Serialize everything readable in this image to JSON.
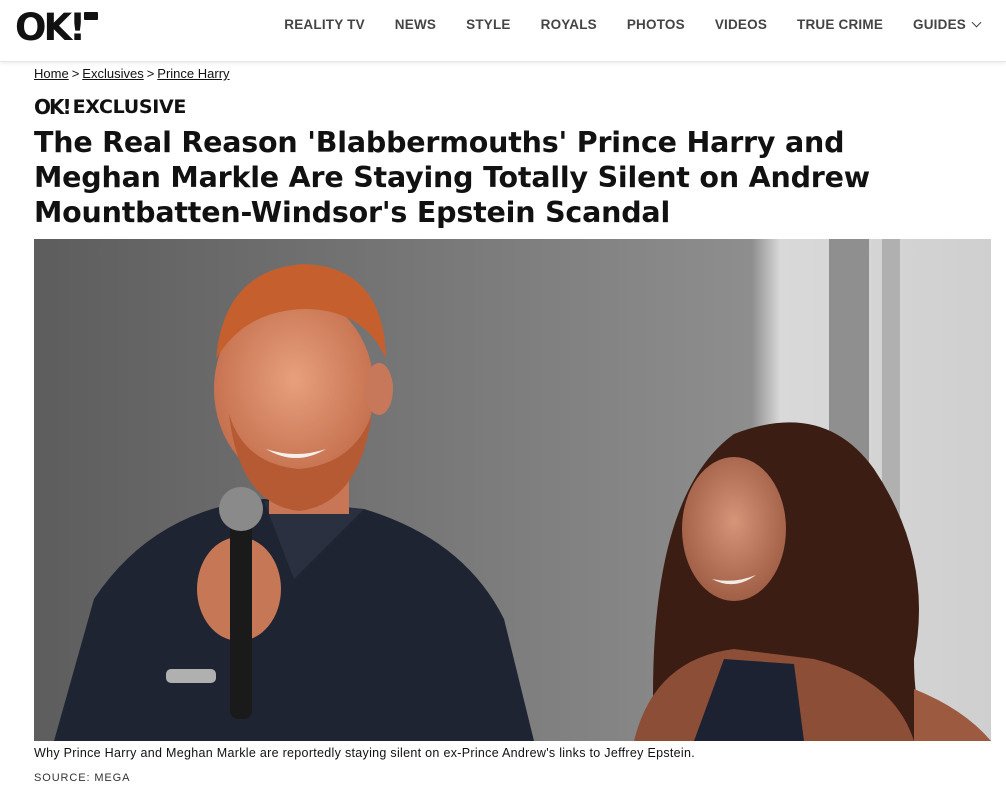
{
  "header": {
    "logo_text": "OK!",
    "nav": [
      {
        "label": "REALITY TV"
      },
      {
        "label": "NEWS"
      },
      {
        "label": "STYLE"
      },
      {
        "label": "ROYALS"
      },
      {
        "label": "PHOTOS"
      },
      {
        "label": "VIDEOS"
      },
      {
        "label": "TRUE CRIME"
      },
      {
        "label": "GUIDES",
        "has_dropdown": true
      }
    ]
  },
  "breadcrumb": {
    "items": [
      "Home",
      "Exclusives",
      "Prince Harry"
    ],
    "separator": ">"
  },
  "article": {
    "label_logo": "OK!",
    "label": "EXCLUSIVE",
    "headline": "The Real Reason 'Blabbermouths' Prince Harry and Meghan Markle Are Staying Totally Silent on Andrew Mountbatten-Windsor's Epstein Scandal",
    "image": {
      "subject": "Prince Harry holding a microphone beside Meghan Markle on stage"
    },
    "caption": "Why Prince Harry and Meghan Markle are reportedly staying silent on ex-Prince Andrew's links to Jeffrey Epstein.",
    "source": "SOURCE: MEGA"
  },
  "icons": {
    "dropdown": "chevron-down-icon"
  }
}
